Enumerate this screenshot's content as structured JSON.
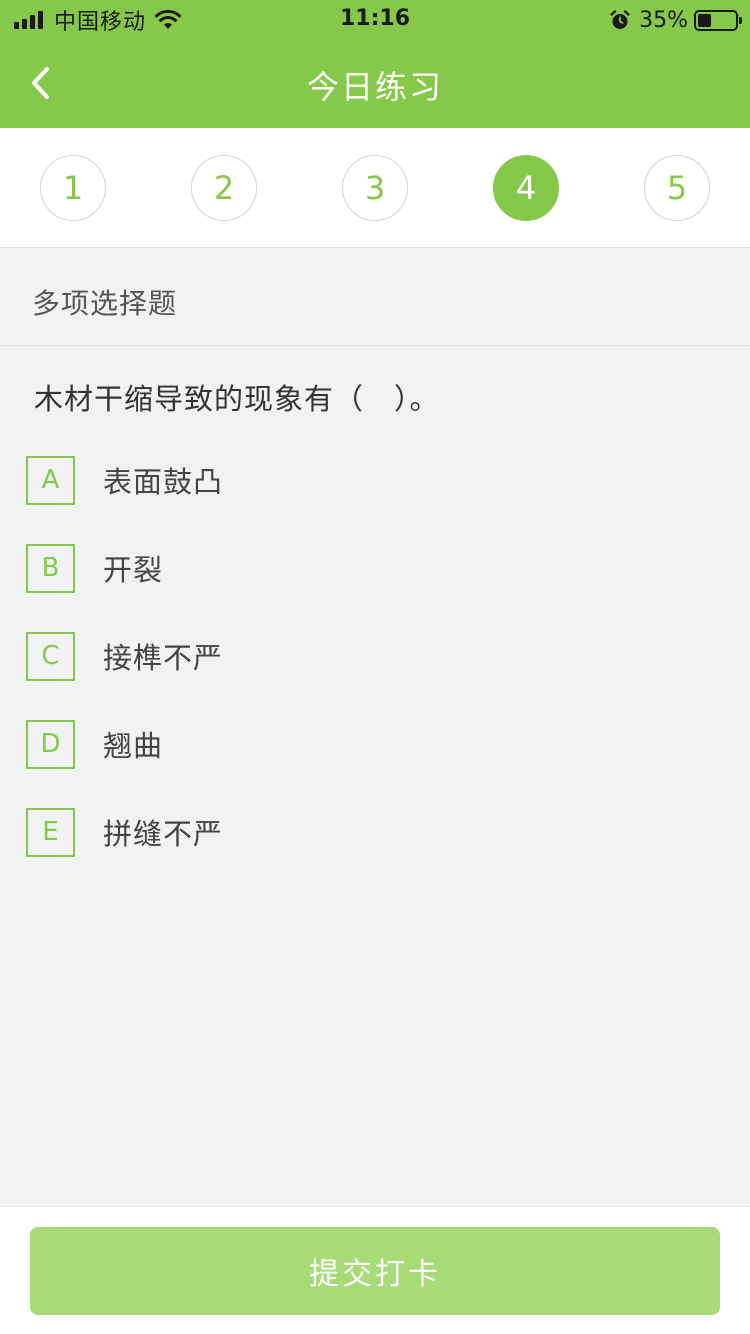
{
  "status_bar": {
    "carrier": "中国移动",
    "time": "11:16",
    "battery_percent": "35%",
    "battery_level": 0.35,
    "icons": [
      "signal-icon",
      "wifi-icon",
      "alarm-icon",
      "battery-icon"
    ]
  },
  "header": {
    "title": "今日练习",
    "back_icon": "chevron-left-icon"
  },
  "question_numbers": {
    "items": [
      "1",
      "2",
      "3",
      "4",
      "5"
    ],
    "active": "4"
  },
  "question": {
    "type": "多项选择题",
    "text": "木材干缩导致的现象有（　）。",
    "options": [
      {
        "letter": "A",
        "text": "表面鼓凸"
      },
      {
        "letter": "B",
        "text": "开裂"
      },
      {
        "letter": "C",
        "text": "接榫不严"
      },
      {
        "letter": "D",
        "text": "翘曲"
      },
      {
        "letter": "E",
        "text": "拼缝不严"
      }
    ]
  },
  "footer": {
    "submit_label": "提交打卡"
  },
  "colors": {
    "accent": "#86c94a",
    "button_disabled": "#a8da78",
    "background": "#f1f2f4"
  }
}
